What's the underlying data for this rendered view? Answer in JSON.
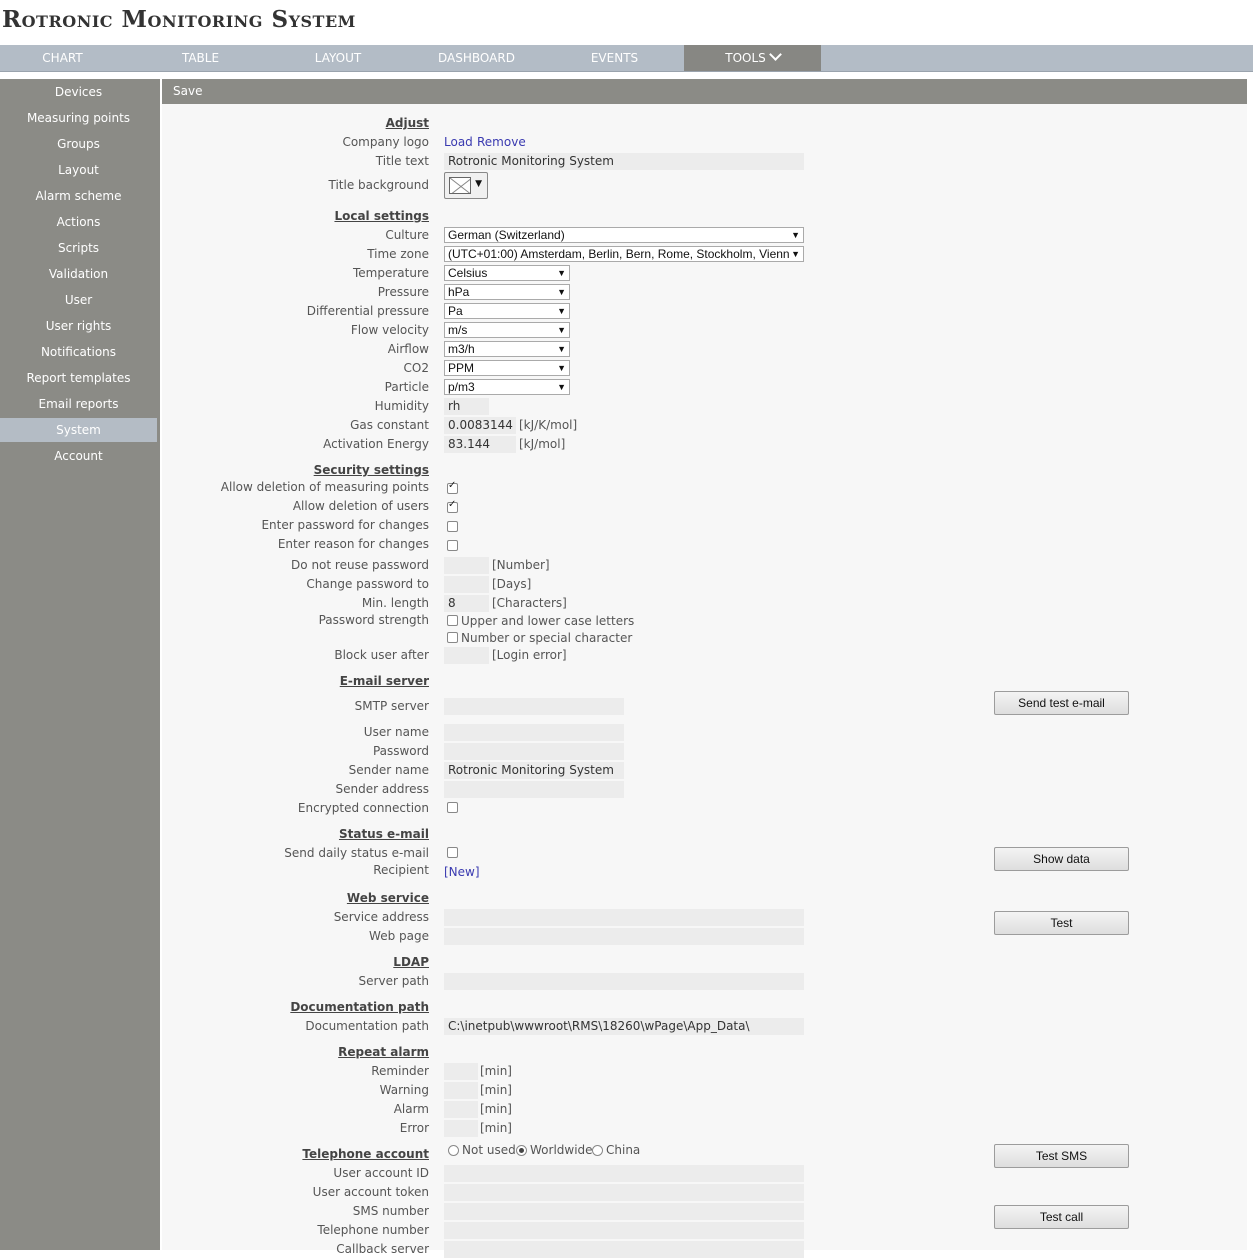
{
  "app": {
    "title": "Rotronic Monitoring System"
  },
  "nav": {
    "tabs": [
      {
        "label": "CHART"
      },
      {
        "label": "TABLE"
      },
      {
        "label": "LAYOUT"
      },
      {
        "label": "DASHBOARD"
      },
      {
        "label": "EVENTS"
      },
      {
        "label": "TOOLS"
      }
    ],
    "active": "TOOLS"
  },
  "sidebar": {
    "items": [
      {
        "label": "Devices"
      },
      {
        "label": "Measuring points"
      },
      {
        "label": "Groups"
      },
      {
        "label": "Layout"
      },
      {
        "label": "Alarm scheme"
      },
      {
        "label": "Actions"
      },
      {
        "label": "Scripts"
      },
      {
        "label": "Validation"
      },
      {
        "label": "User"
      },
      {
        "label": "User rights"
      },
      {
        "label": "Notifications"
      },
      {
        "label": "Report templates"
      },
      {
        "label": "Email reports"
      },
      {
        "label": "System"
      },
      {
        "label": "Account"
      }
    ],
    "active": "System"
  },
  "toolbar": {
    "save_label": "Save"
  },
  "adjust": {
    "heading": "Adjust",
    "company_logo_label": "Company logo",
    "load_link": "Load",
    "remove_link": "Remove",
    "title_text_label": "Title text",
    "title_text_value": "Rotronic Monitoring System",
    "title_background_label": "Title background"
  },
  "local": {
    "heading": "Local settings",
    "culture": {
      "label": "Culture",
      "value": "German (Switzerland)"
    },
    "time_zone": {
      "label": "Time zone",
      "value": "(UTC+01:00) Amsterdam, Berlin, Bern, Rome, Stockholm, Vienna"
    },
    "temperature": {
      "label": "Temperature",
      "value": "Celsius"
    },
    "pressure": {
      "label": "Pressure",
      "value": "hPa"
    },
    "diff_pressure": {
      "label": "Differential pressure",
      "value": "Pa"
    },
    "flow_velocity": {
      "label": "Flow velocity",
      "value": "m/s"
    },
    "airflow": {
      "label": "Airflow",
      "value": "m3/h"
    },
    "co2": {
      "label": "CO2",
      "value": "PPM"
    },
    "particle": {
      "label": "Particle",
      "value": "p/m3"
    },
    "humidity": {
      "label": "Humidity",
      "value": "rh"
    },
    "gas_constant": {
      "label": "Gas constant",
      "value": "0.0083144",
      "unit": "[kJ/K/mol]"
    },
    "activation_energy": {
      "label": "Activation Energy",
      "value": "83.144",
      "unit": "[kJ/mol]"
    }
  },
  "security": {
    "heading": "Security settings",
    "allow_delete_mp": {
      "label": "Allow deletion of measuring points",
      "checked": true
    },
    "allow_delete_users": {
      "label": "Allow deletion of users",
      "checked": true
    },
    "enter_password": {
      "label": "Enter password for changes",
      "checked": false
    },
    "enter_reason": {
      "label": "Enter reason for changes",
      "checked": false
    },
    "no_reuse": {
      "label": "Do not reuse password",
      "value": "",
      "unit": "[Number]"
    },
    "change_pw": {
      "label": "Change password to",
      "value": "",
      "unit": "[Days]"
    },
    "min_length": {
      "label": "Min. length",
      "value": "8",
      "unit": "[Characters]"
    },
    "pw_strength_label": "Password strength",
    "upper_lower": {
      "label": "Upper and lower case letters",
      "checked": false
    },
    "number_special": {
      "label": "Number or special character",
      "checked": false
    },
    "block_user": {
      "label": "Block user after",
      "value": "",
      "unit": "[Login error]"
    }
  },
  "email": {
    "heading": "E-mail server",
    "smtp": {
      "label": "SMTP server",
      "value": ""
    },
    "user": {
      "label": "User name",
      "value": ""
    },
    "password": {
      "label": "Password",
      "value": ""
    },
    "sender_name": {
      "label": "Sender name",
      "value": "Rotronic Monitoring System"
    },
    "sender_address": {
      "label": "Sender address",
      "value": ""
    },
    "encrypted": {
      "label": "Encrypted connection",
      "checked": false
    },
    "test_button": "Send test e-mail"
  },
  "status_email": {
    "heading": "Status e-mail",
    "daily": {
      "label": "Send daily status e-mail",
      "checked": false
    },
    "recipient_label": "Recipient",
    "new_link": "[New]",
    "show_button": "Show data"
  },
  "web_service": {
    "heading": "Web service",
    "service_address": {
      "label": "Service address",
      "value": ""
    },
    "web_page": {
      "label": "Web page",
      "value": ""
    },
    "test_button": "Test"
  },
  "ldap": {
    "heading": "LDAP",
    "server_path": {
      "label": "Server path",
      "value": ""
    }
  },
  "docs": {
    "heading": "Documentation path",
    "path": {
      "label": "Documentation path",
      "value": "C:\\inetpub\\wwwroot\\RMS\\18260\\wPage\\App_Data\\"
    }
  },
  "repeat_alarm": {
    "heading": "Repeat alarm",
    "reminder": {
      "label": "Reminder",
      "value": "",
      "unit": "[min]"
    },
    "warning": {
      "label": "Warning",
      "value": "",
      "unit": "[min]"
    },
    "alarm": {
      "label": "Alarm",
      "value": "",
      "unit": "[min]"
    },
    "error": {
      "label": "Error",
      "value": "",
      "unit": "[min]"
    }
  },
  "telephone": {
    "heading": "Telephone account",
    "options": [
      "Not used",
      "Worldwide",
      "China"
    ],
    "selected": "Worldwide",
    "account_id": {
      "label": "User account ID",
      "value": ""
    },
    "account_token": {
      "label": "User account token",
      "value": ""
    },
    "sms_number": {
      "label": "SMS number",
      "value": ""
    },
    "phone_number": {
      "label": "Telephone number",
      "value": ""
    },
    "callback": {
      "label": "Callback server",
      "value": ""
    },
    "test_sms_button": "Test SMS",
    "test_call_button": "Test call"
  }
}
